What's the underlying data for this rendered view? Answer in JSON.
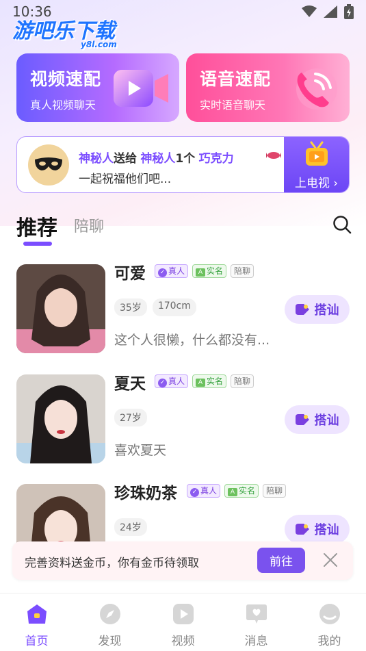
{
  "status_bar": {
    "time": "10:36"
  },
  "watermark": {
    "text": "游吧乐下载",
    "sub": "y8l.com"
  },
  "match_cards": [
    {
      "title": "视频速配",
      "subtitle": "真人视频聊天"
    },
    {
      "title": "语音速配",
      "subtitle": "实时语音聊天"
    }
  ],
  "gift_banner": {
    "sender": "神秘人",
    "verb": "送给",
    "receiver": "神秘人",
    "count": "1个",
    "gift": "巧克力",
    "message": "一起祝福他们吧...",
    "tv_button": "上电视 ›"
  },
  "tabs": {
    "active": "推荐",
    "inactive": "陪聊"
  },
  "badges": {
    "real": "真人",
    "verified": "实名",
    "companion": "陪聊"
  },
  "chat_button_label": "搭讪",
  "users": [
    {
      "name": "可爱",
      "tags": [
        "35岁",
        "170cm"
      ],
      "bio": "这个人很懒，什么都没有..."
    },
    {
      "name": "夏天",
      "tags": [
        "27岁"
      ],
      "bio": "喜欢夏天"
    },
    {
      "name": "珍珠奶茶",
      "tags": [
        "24岁"
      ],
      "bio": ""
    }
  ],
  "promo": {
    "text": "完善资料送金币，你有金币待领取",
    "button": "前往"
  },
  "bottom_nav": [
    {
      "label": "首页",
      "icon": "home-icon",
      "active": true
    },
    {
      "label": "发现",
      "icon": "compass-icon",
      "active": false
    },
    {
      "label": "视频",
      "icon": "video-icon",
      "active": false
    },
    {
      "label": "消息",
      "icon": "message-icon",
      "active": false
    },
    {
      "label": "我的",
      "icon": "profile-icon",
      "active": false
    }
  ],
  "colors": {
    "accent": "#7b4dff",
    "video_card": "#6b5cff",
    "voice_card": "#ff4f9a"
  }
}
